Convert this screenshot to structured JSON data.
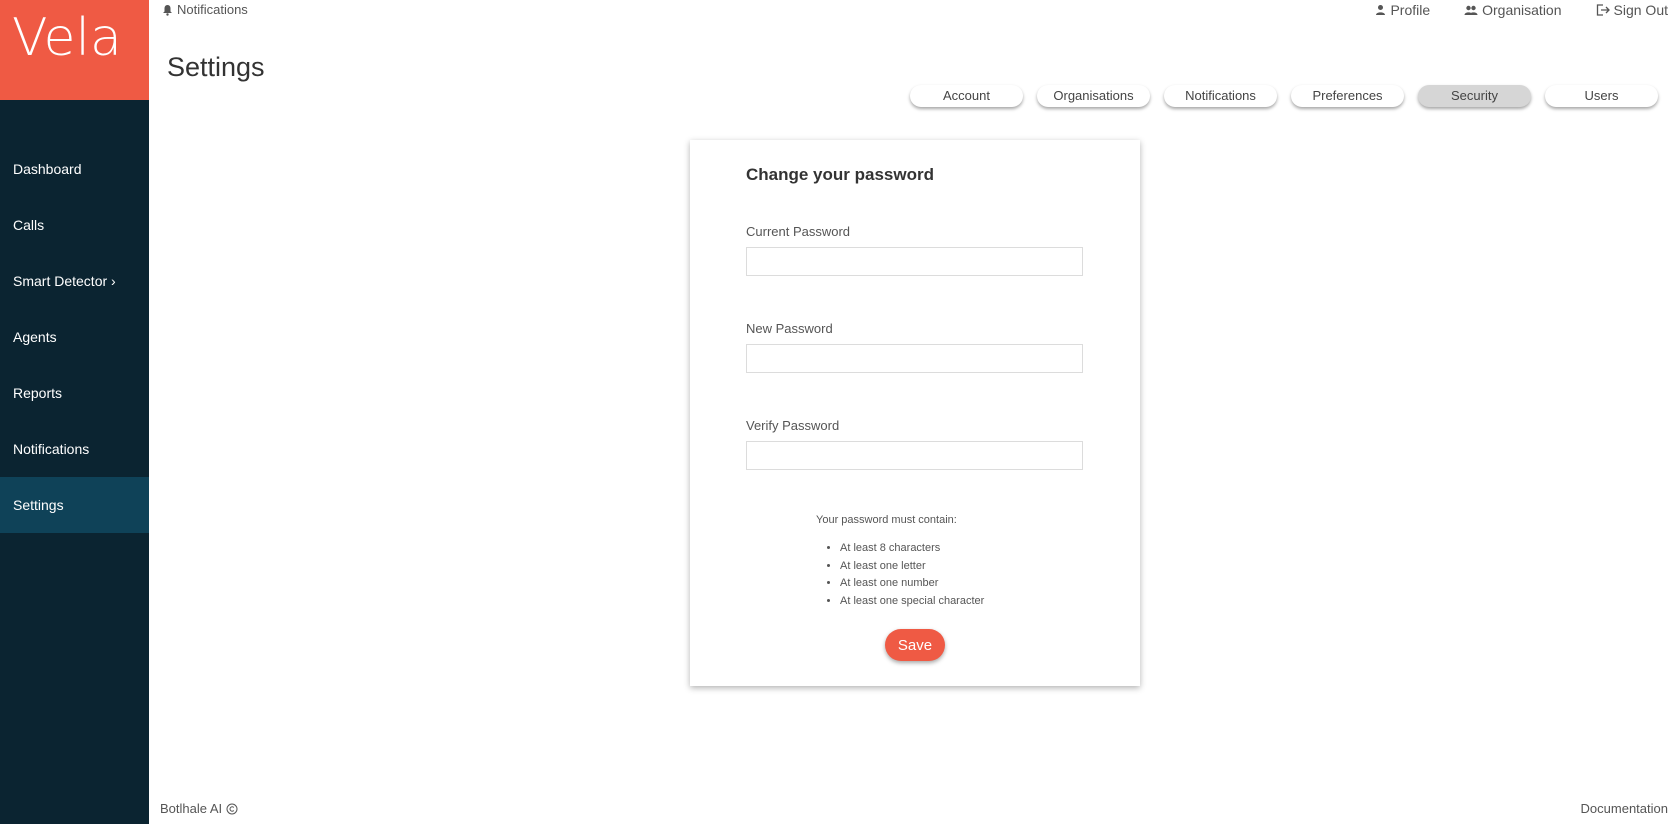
{
  "app": {
    "logo_text": "Vela",
    "brand_color": "#ef5a44",
    "sidebar_color": "#0b2431",
    "sidebar_active_color": "#0f4258"
  },
  "sidebar": {
    "items": [
      {
        "label": "Dashboard"
      },
      {
        "label": "Calls"
      },
      {
        "label": "Smart Detector ›"
      },
      {
        "label": "Agents"
      },
      {
        "label": "Reports"
      },
      {
        "label": "Notifications"
      },
      {
        "label": "Settings",
        "active": true
      }
    ]
  },
  "topbar": {
    "notifications_label": "Notifications",
    "notifications_icon": "bell-icon",
    "profile_label": "Profile",
    "profile_icon": "person-icon",
    "organisation_label": "Organisation",
    "organisation_icon": "people-icon",
    "signout_label": "Sign Out",
    "signout_icon": "sign-out-icon"
  },
  "page": {
    "title": "Settings"
  },
  "tabs": [
    {
      "label": "Account"
    },
    {
      "label": "Organisations"
    },
    {
      "label": "Notifications"
    },
    {
      "label": "Preferences"
    },
    {
      "label": "Security",
      "active": true
    },
    {
      "label": "Users"
    }
  ],
  "form": {
    "title": "Change your password",
    "current_label": "Current Password",
    "current_value": "",
    "new_label": "New Password",
    "new_value": "",
    "verify_label": "Verify Password",
    "verify_value": "",
    "hint_title": "Your password must contain:",
    "rules": [
      "At least 8 characters",
      "At least one letter",
      "At least one number",
      "At least one special character"
    ],
    "save_label": "Save"
  },
  "footer": {
    "company": "Botlhale AI",
    "copyright_icon": "copyright-icon",
    "documentation": "Documentation"
  }
}
